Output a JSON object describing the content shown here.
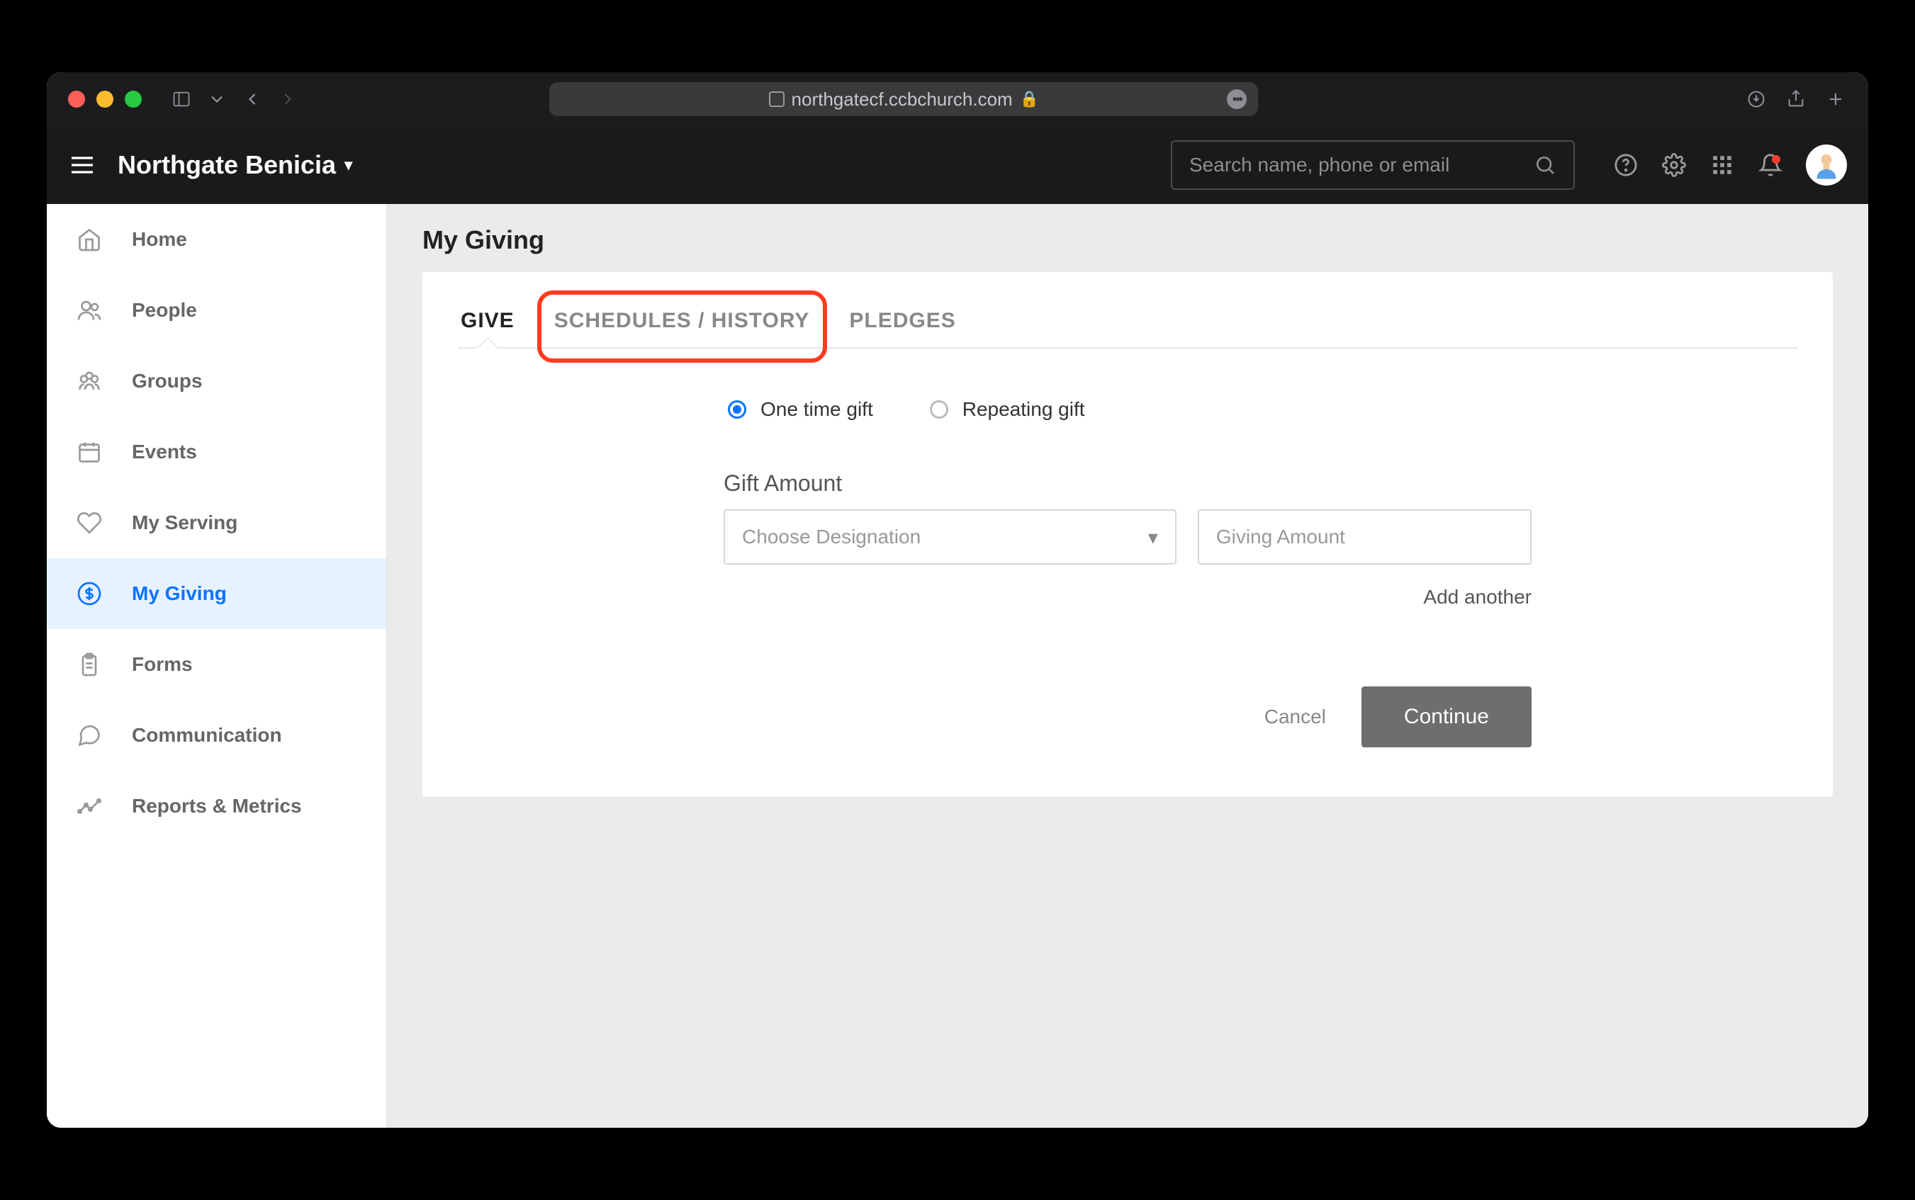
{
  "browser": {
    "address": "northgatecf.ccbchurch.com"
  },
  "header": {
    "org_name": "Northgate Benicia",
    "search_placeholder": "Search name, phone or email"
  },
  "sidebar": {
    "items": [
      {
        "label": "Home"
      },
      {
        "label": "People"
      },
      {
        "label": "Groups"
      },
      {
        "label": "Events"
      },
      {
        "label": "My Serving"
      },
      {
        "label": "My Giving"
      },
      {
        "label": "Forms"
      },
      {
        "label": "Communication"
      },
      {
        "label": "Reports & Metrics"
      }
    ]
  },
  "page": {
    "title": "My Giving",
    "tabs": {
      "give": "GIVE",
      "schedules": "SCHEDULES / HISTORY",
      "pledges": "PLEDGES"
    },
    "gift_type": {
      "one_time": "One time gift",
      "repeating": "Repeating gift"
    },
    "section_label": "Gift Amount",
    "designation_placeholder": "Choose Designation",
    "amount_placeholder": "Giving Amount",
    "add_another": "Add another",
    "cancel": "Cancel",
    "continue": "Continue"
  },
  "annotation": {
    "highlight_tab": "schedules"
  }
}
